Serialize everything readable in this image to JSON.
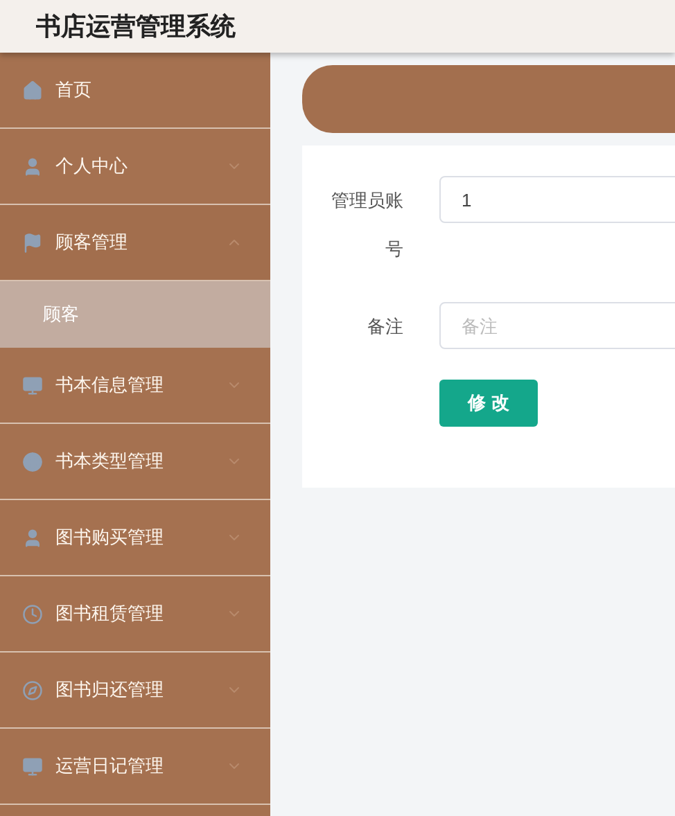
{
  "header": {
    "title": "书店运营管理系统"
  },
  "sidebar": {
    "items": [
      {
        "label": "首页",
        "kind": "link"
      },
      {
        "label": "个人中心",
        "kind": "menu",
        "expanded": false
      },
      {
        "label": "顾客管理",
        "kind": "menu",
        "expanded": true,
        "children": [
          {
            "label": "顾客",
            "selected": true
          }
        ]
      },
      {
        "label": "书本信息管理",
        "kind": "menu",
        "expanded": false
      },
      {
        "label": "书本类型管理",
        "kind": "menu",
        "expanded": false
      },
      {
        "label": "图书购买管理",
        "kind": "menu",
        "expanded": false
      },
      {
        "label": "图书租赁管理",
        "kind": "menu",
        "expanded": false
      },
      {
        "label": "图书归还管理",
        "kind": "menu",
        "expanded": false
      },
      {
        "label": "运营日记管理",
        "kind": "menu",
        "expanded": false
      }
    ]
  },
  "form": {
    "fields": [
      {
        "label": "管理员账号",
        "value": "1"
      },
      {
        "label": "备注",
        "placeholder": "备注"
      }
    ],
    "submit": "修 改"
  }
}
